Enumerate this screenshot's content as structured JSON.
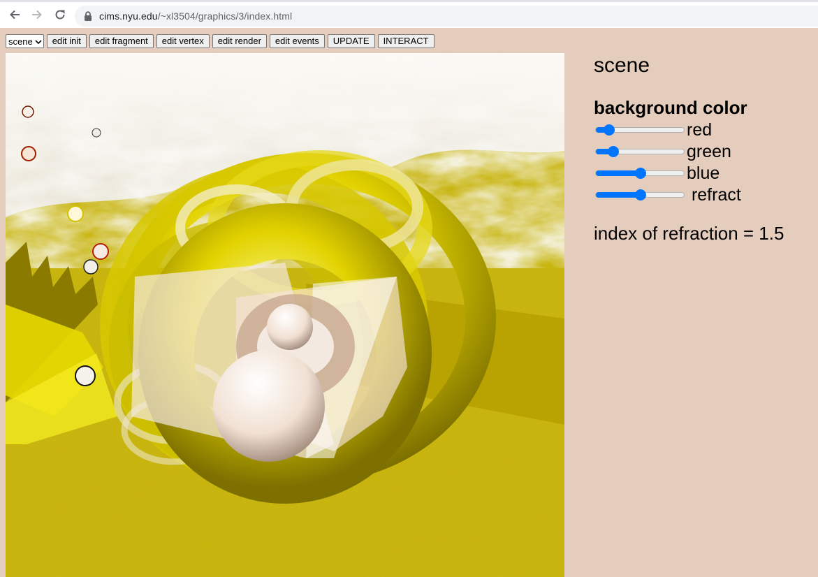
{
  "browser": {
    "url_host": "cims.nyu.edu",
    "url_path": "/~xl3504/graphics/3/index.html"
  },
  "toolbar": {
    "scene_select": {
      "selected": "scene"
    },
    "buttons": [
      "edit init",
      "edit fragment",
      "edit vertex",
      "edit render",
      "edit events",
      "UPDATE",
      "INTERACT"
    ]
  },
  "panel": {
    "title": "scene",
    "background_heading": "background color",
    "sliders": [
      {
        "label": "red",
        "value": 0.1
      },
      {
        "label": "green",
        "value": 0.15
      },
      {
        "label": "blue",
        "value": 0.5
      },
      {
        "label": " refract",
        "value": 0.5
      }
    ],
    "ior_text": "index of refraction = 1.5"
  },
  "colors": {
    "page_bg": "#e4cdbd",
    "slider_accent": "#0075ff",
    "scene_yellow": "#c8b400",
    "sky": "#f2efe8"
  },
  "icons": {
    "back": "arrow-left-icon",
    "forward": "arrow-right-icon",
    "reload": "reload-icon",
    "lock": "lock-icon",
    "select": "chevron-down-icon"
  }
}
